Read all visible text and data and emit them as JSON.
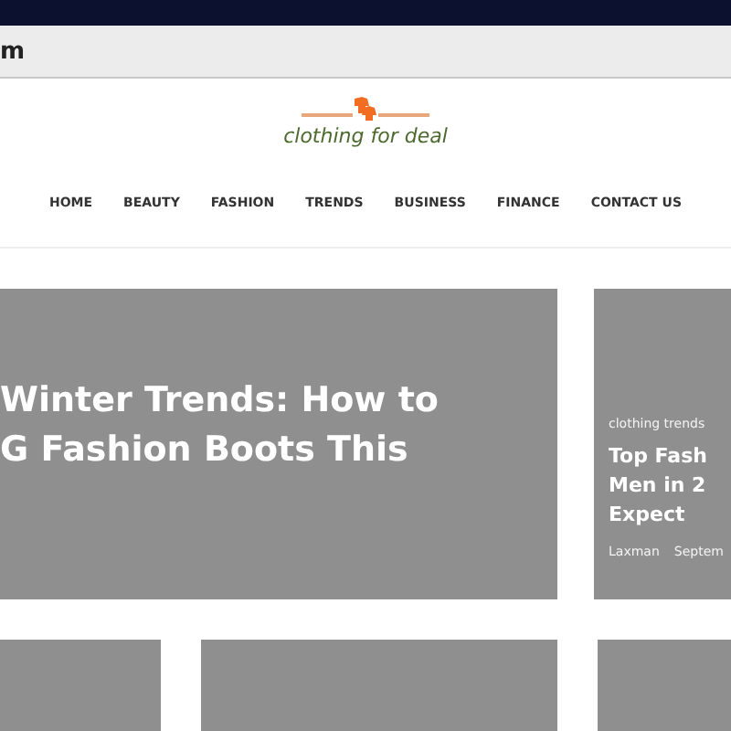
{
  "browser": {
    "address": "m"
  },
  "site": {
    "logo_text": "clothing for deal"
  },
  "nav": [
    {
      "label": "HOME"
    },
    {
      "label": "BEAUTY"
    },
    {
      "label": "FASHION"
    },
    {
      "label": "TRENDS"
    },
    {
      "label": "BUSINESS"
    },
    {
      "label": "FINANCE"
    },
    {
      "label": "CONTACT US"
    }
  ],
  "featured": {
    "title_lines": [
      "Winter Trends: How to",
      "G Fashion Boots This"
    ]
  },
  "side_post": {
    "category": "clothing trends",
    "title_lines": [
      "Top Fash",
      "Men in 2",
      "Expect"
    ],
    "author": "Laxman",
    "date": "Septem"
  }
}
